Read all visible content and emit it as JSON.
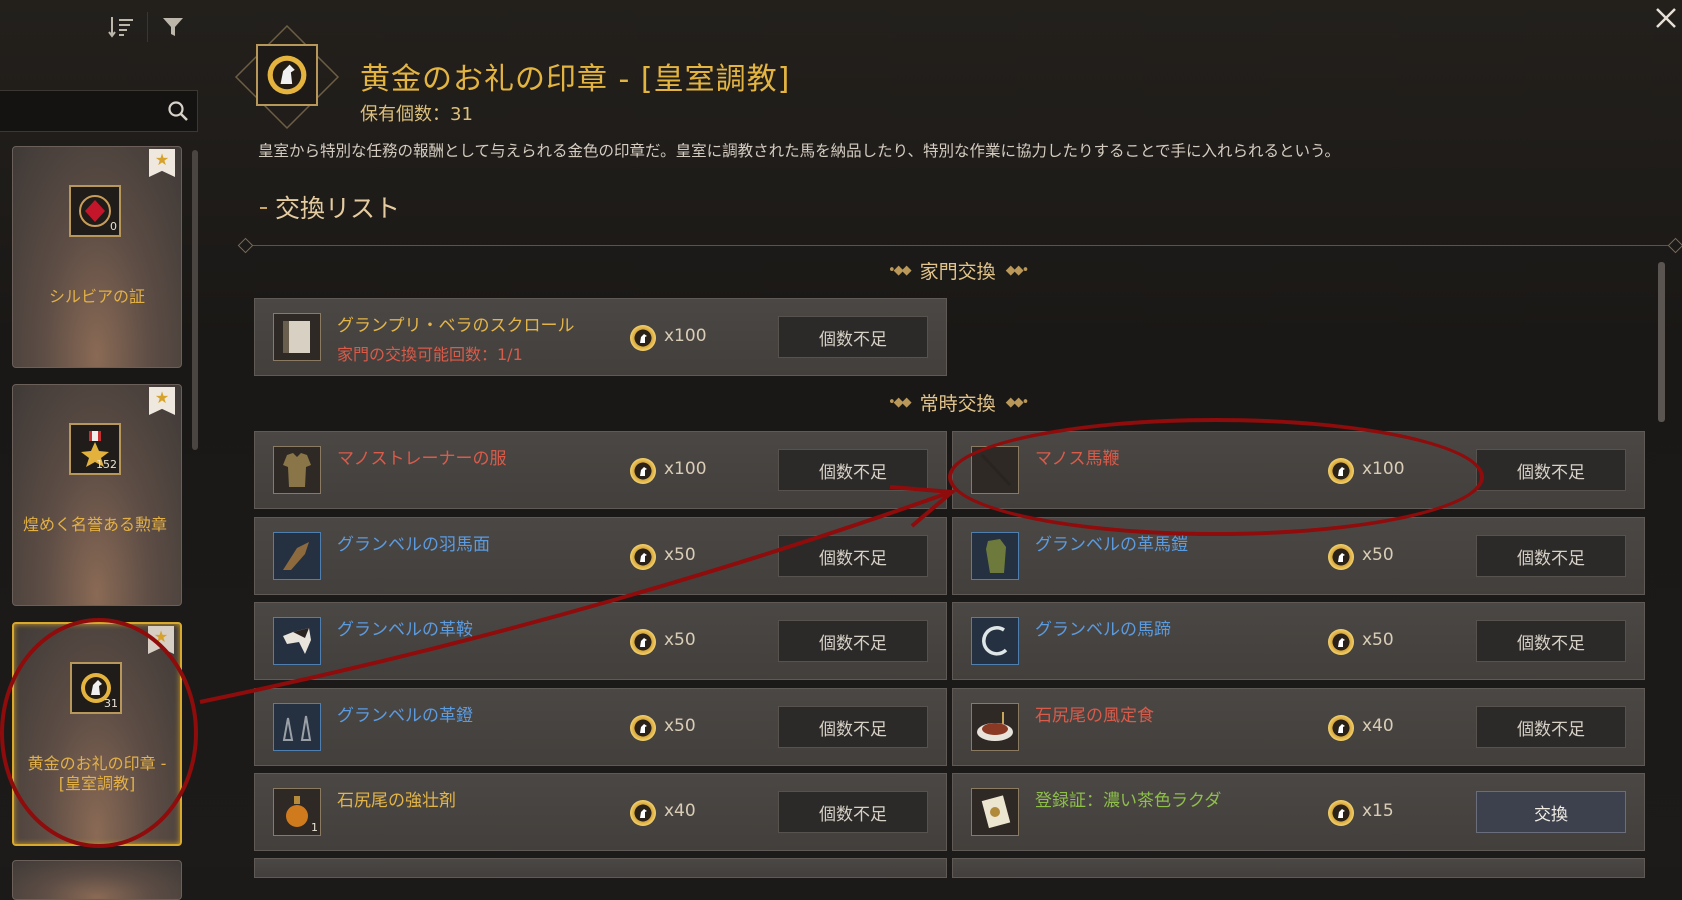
{
  "sidebar": {
    "cards": [
      {
        "label": "シルビアの証",
        "count": "0",
        "icon": "red-gem-icon"
      },
      {
        "label": "煌めく名誉ある勲章",
        "count": "152",
        "icon": "star-medal-icon"
      },
      {
        "label": "黄金のお礼の印章 - [皇室調教]",
        "count": "31",
        "icon": "gold-horse-seal-icon",
        "selected": true
      }
    ]
  },
  "header": {
    "title": "黄金のお礼の印章 - [皇室調教]",
    "owned": "保有個数：31",
    "description": "皇室から特別な任務の報酬として与えられる金色の印章だ。皇室に調教された馬を納品したり、特別な作業に協力したりすることで手に入れられるという。"
  },
  "section": {
    "title": "交換リスト",
    "family_header": "家門交換",
    "regular_header": "常時交換"
  },
  "family_items": [
    {
      "name": "グランプリ・ベラのスクロール",
      "sub": "家門の交換可能回数：1/1",
      "cost": "x100",
      "button": "個数不足",
      "color": "yellow",
      "icon": "scroll-icon"
    }
  ],
  "regular_items": [
    {
      "name": "マノストレーナーの服",
      "cost": "x100",
      "button": "個数不足",
      "color": "red",
      "icon": "armor-icon"
    },
    {
      "name": "マノス馬鞭",
      "cost": "x100",
      "button": "個数不足",
      "color": "red",
      "icon": "whip-icon"
    },
    {
      "name": "グランベルの羽馬面",
      "cost": "x50",
      "button": "個数不足",
      "color": "blue",
      "icon": "horse-chanfron-icon"
    },
    {
      "name": "グランベルの革馬鎧",
      "cost": "x50",
      "button": "個数不足",
      "color": "blue",
      "icon": "horse-barding-icon"
    },
    {
      "name": "グランベルの革鞍",
      "cost": "x50",
      "button": "個数不足",
      "color": "blue",
      "icon": "saddle-icon"
    },
    {
      "name": "グランベルの馬蹄",
      "cost": "x50",
      "button": "個数不足",
      "color": "blue",
      "icon": "horseshoe-icon"
    },
    {
      "name": "グランベルの革鐙",
      "cost": "x50",
      "button": "個数不足",
      "color": "blue",
      "icon": "stirrup-icon"
    },
    {
      "name": "石尻尾の風定食",
      "cost": "x40",
      "button": "個数不足",
      "color": "red",
      "icon": "meal-icon"
    },
    {
      "name": "石尻尾の強壮剤",
      "cost": "x40",
      "button": "個数不足",
      "color": "yellow",
      "icon": "tonic-icon",
      "qty": "1"
    },
    {
      "name": "登録証：濃い茶色ラクダ",
      "cost": "x15",
      "button": "交換",
      "color": "green",
      "icon": "registration-icon",
      "active": true
    }
  ]
}
